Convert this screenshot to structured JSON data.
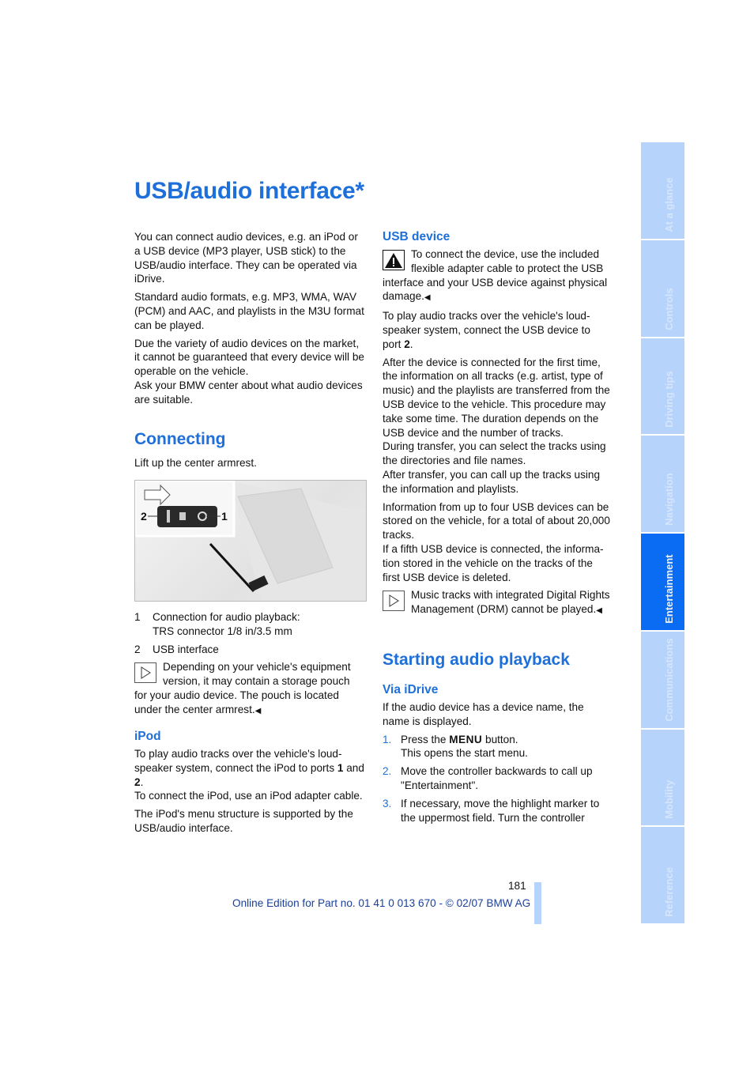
{
  "title": "USB/audio interface",
  "title_mark": "*",
  "left": {
    "intro": [
      "You can connect audio devices, e.g. an iPod or a USB device (MP3 player, USB stick) to the USB/audio interface. They can be operated via iDrive.",
      "Standard audio formats, e.g. MP3, WMA, WAV (PCM) and AAC, and playlists in the M3U format can be played.",
      "Due the variety of audio devices on the market, it cannot be guaranteed that every device will be operable on the vehicle.",
      "Ask your BMW center about what audio devices are suitable."
    ],
    "connecting": {
      "heading": "Connecting",
      "text": "Lift up the center armrest.",
      "figure_labels": [
        "2",
        "1"
      ],
      "legend": [
        {
          "num": "1",
          "text": "Connection for audio playback:",
          "text2": "TRS connector 1/8 in/3.5 mm"
        },
        {
          "num": "2",
          "text": "USB interface"
        }
      ],
      "note": "Depending on your vehicle's equipment version, it may contain a storage pouch for your audio device. The pouch is located under the center armrest."
    },
    "ipod": {
      "heading": "iPod",
      "p1a": "To play audio tracks over the vehicle's loud-speaker system, connect the iPod to ports ",
      "p1b": "1",
      "p1c": " and ",
      "p1d": "2",
      "p1e": ".",
      "p2": "To connect the iPod, use an iPod adapter cable.",
      "p3": "The iPod's menu structure is supported by the USB/audio interface."
    }
  },
  "right": {
    "usb": {
      "heading": "USB device",
      "warning": "To connect the device, use the included flexible adapter cable to protect the USB interface and your USB device against physical damage.",
      "p1a": "To play audio tracks over the vehicle's loud-speaker system, connect the USB device to port ",
      "p1b": "2",
      "p1c": ".",
      "p2": "After the device is connected for the first time, the information on all tracks (e.g. artist, type of music) and the playlists are transferred from the USB device to the vehicle. This procedure may take some time. The duration depends on the USB device and the number of tracks.",
      "p3": "During transfer, you can select the tracks using the directories and file names.",
      "p4": "After transfer, you can call up the tracks using the information and playlists.",
      "p5": "Information from up to four USB devices can be stored on the vehicle, for a total of about 20,000 tracks.",
      "p6": "If a fifth USB device is connected, the informa-tion stored in the vehicle on the tracks of the first USB device is deleted.",
      "note": "Music tracks with integrated Digital Rights Management (DRM) cannot be played."
    },
    "playback": {
      "heading": "Starting audio playback",
      "sub": "Via iDrive",
      "intro": "If the audio device has a device name, the name is displayed.",
      "steps": [
        {
          "num": "1.",
          "a": "Press the ",
          "b": "MENU",
          "c": " button.",
          "d": "This opens the start menu."
        },
        {
          "num": "2.",
          "a": "Move the controller backwards to call up \"Entertainment\"."
        },
        {
          "num": "3.",
          "a": "If necessary, move the highlight marker to the uppermost field. Turn the controller"
        }
      ]
    }
  },
  "sidebar_tabs": [
    {
      "label": "At a glance",
      "active": false
    },
    {
      "label": "Controls",
      "active": false
    },
    {
      "label": "Driving tips",
      "active": false
    },
    {
      "label": "Navigation",
      "active": false
    },
    {
      "label": "Entertainment",
      "active": true
    },
    {
      "label": "Communications",
      "active": false
    },
    {
      "label": "Mobility",
      "active": false
    },
    {
      "label": "Reference",
      "active": false
    }
  ],
  "page_number": "181",
  "footer": "Online Edition for Part no. 01 41 0 013 670 - © 02/07 BMW AG",
  "icons": {
    "end_mark": "◀",
    "note": "triangle-right-icon",
    "warning": "warning-icon"
  },
  "colors": {
    "heading": "#1e6fd9",
    "tab": "#b6d3fb",
    "tab_active": "#0a6cf2"
  }
}
